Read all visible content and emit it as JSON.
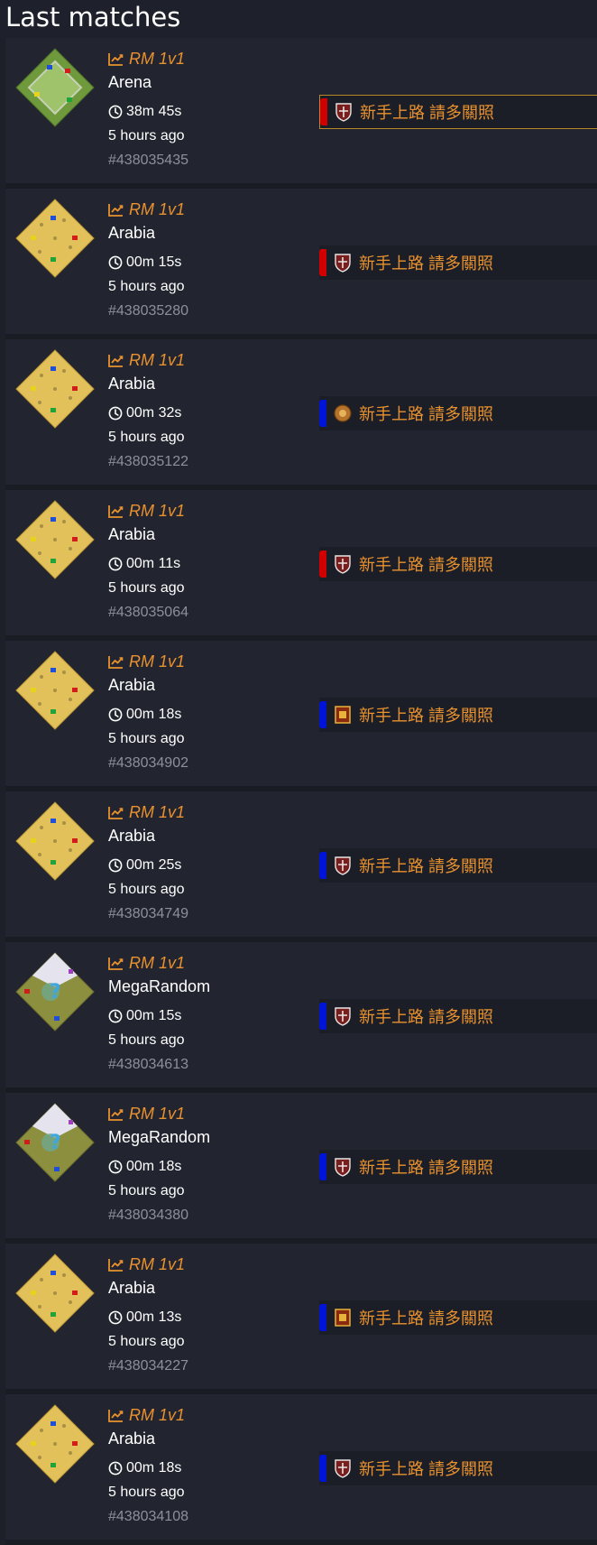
{
  "header": {
    "title": "Last matches"
  },
  "colors": {
    "accent": "#e8912f",
    "red": "#d10000",
    "blue": "#0014d8"
  },
  "matches": [
    {
      "mode": "RM 1v1",
      "map": "Arena",
      "map_icon": "arena-map-icon",
      "duration": "38m 45s",
      "ago": "5 hours ago",
      "id": "#438035435",
      "player": {
        "name": "新手上路 請多關照",
        "color": "red",
        "civ_icon": "civ-shield-icon",
        "highlight": true
      }
    },
    {
      "mode": "RM 1v1",
      "map": "Arabia",
      "map_icon": "arabia-map-icon",
      "duration": "00m 15s",
      "ago": "5 hours ago",
      "id": "#438035280",
      "player": {
        "name": "新手上路 請多關照",
        "color": "red",
        "civ_icon": "civ-shield-icon",
        "highlight": false
      }
    },
    {
      "mode": "RM 1v1",
      "map": "Arabia",
      "map_icon": "arabia-map-icon",
      "duration": "00m 32s",
      "ago": "5 hours ago",
      "id": "#438035122",
      "player": {
        "name": "新手上路 請多關照",
        "color": "blue",
        "civ_icon": "civ-round-icon",
        "highlight": false
      }
    },
    {
      "mode": "RM 1v1",
      "map": "Arabia",
      "map_icon": "arabia-map-icon",
      "duration": "00m 11s",
      "ago": "5 hours ago",
      "id": "#438035064",
      "player": {
        "name": "新手上路 請多關照",
        "color": "red",
        "civ_icon": "civ-shield-icon",
        "highlight": false
      }
    },
    {
      "mode": "RM 1v1",
      "map": "Arabia",
      "map_icon": "arabia-map-icon",
      "duration": "00m 18s",
      "ago": "5 hours ago",
      "id": "#438034902",
      "player": {
        "name": "新手上路 請多關照",
        "color": "blue",
        "civ_icon": "civ-banner-icon",
        "highlight": false
      }
    },
    {
      "mode": "RM 1v1",
      "map": "Arabia",
      "map_icon": "arabia-map-icon",
      "duration": "00m 25s",
      "ago": "5 hours ago",
      "id": "#438034749",
      "player": {
        "name": "新手上路 請多關照",
        "color": "blue",
        "civ_icon": "civ-shield-icon",
        "highlight": false
      }
    },
    {
      "mode": "RM 1v1",
      "map": "MegaRandom",
      "map_icon": "megarandom-map-icon",
      "duration": "00m 15s",
      "ago": "5 hours ago",
      "id": "#438034613",
      "player": {
        "name": "新手上路 請多關照",
        "color": "blue",
        "civ_icon": "civ-shield-icon",
        "highlight": false
      }
    },
    {
      "mode": "RM 1v1",
      "map": "MegaRandom",
      "map_icon": "megarandom-map-icon",
      "duration": "00m 18s",
      "ago": "5 hours ago",
      "id": "#438034380",
      "player": {
        "name": "新手上路 請多關照",
        "color": "blue",
        "civ_icon": "civ-shield-icon",
        "highlight": false
      }
    },
    {
      "mode": "RM 1v1",
      "map": "Arabia",
      "map_icon": "arabia-map-icon",
      "duration": "00m 13s",
      "ago": "5 hours ago",
      "id": "#438034227",
      "player": {
        "name": "新手上路 請多關照",
        "color": "blue",
        "civ_icon": "civ-banner-icon",
        "highlight": false
      }
    },
    {
      "mode": "RM 1v1",
      "map": "Arabia",
      "map_icon": "arabia-map-icon",
      "duration": "00m 18s",
      "ago": "5 hours ago",
      "id": "#438034108",
      "player": {
        "name": "新手上路 請多關照",
        "color": "blue",
        "civ_icon": "civ-shield-icon",
        "highlight": false
      }
    }
  ]
}
